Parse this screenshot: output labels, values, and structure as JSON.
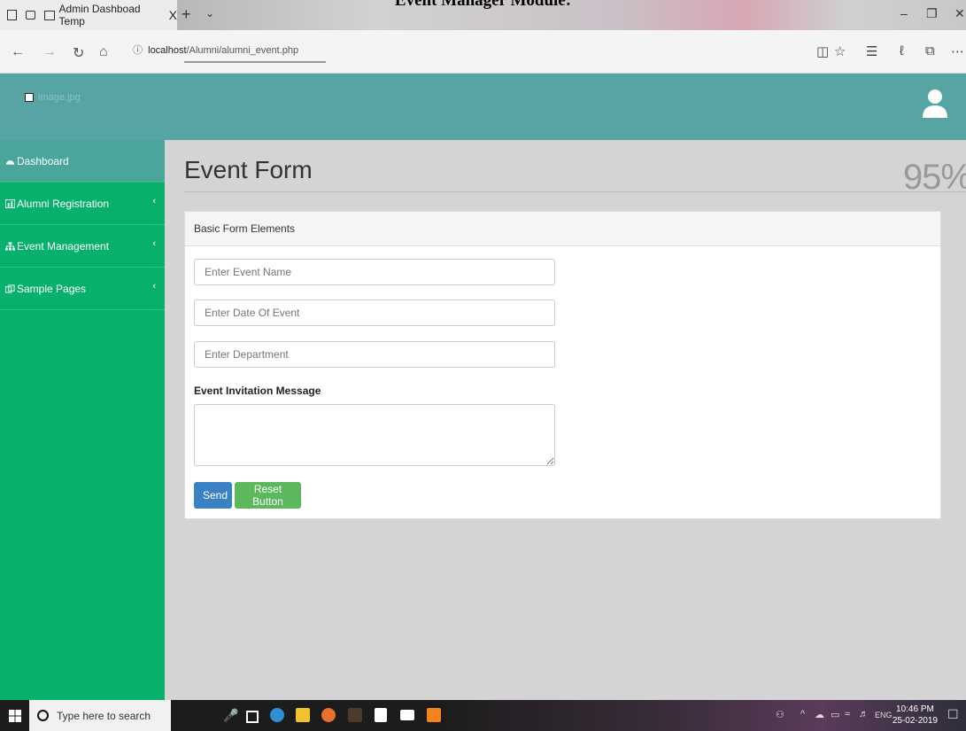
{
  "caption": "Event Manager Module:",
  "browser": {
    "tab_title": "Admin Dashboad Temp",
    "tab_close": "X",
    "new_tab": "+",
    "url_host": "localhost",
    "url_path": "/Alumni/alumni_event.php"
  },
  "header": {
    "logo_alt": "image.jpg"
  },
  "sidebar": {
    "items": [
      {
        "label": "Dashboard",
        "icon": "dashboard-icon"
      },
      {
        "label": "Alumni Registration",
        "icon": "chart-icon"
      },
      {
        "label": "Event Management",
        "icon": "sitemap-icon"
      },
      {
        "label": "Sample Pages",
        "icon": "pages-icon"
      }
    ]
  },
  "main": {
    "title": "Event Form",
    "percent": "95%",
    "panel_title": "Basic Form Elements",
    "event_name_placeholder": "Enter Event Name",
    "event_date_placeholder": "Enter Date Of Event",
    "department_placeholder": "Enter Department",
    "message_label": "Event Invitation Message",
    "send_label": "Send",
    "reset_label": "Reset Button"
  },
  "taskbar": {
    "search_placeholder": "Type here to search",
    "lang": "ENG",
    "time": "10:46 PM",
    "date": "25-02-2019"
  },
  "colors": {
    "header": "#56a4a4",
    "sidebar": "#07b06b",
    "sidebar_active": "#4aa69a",
    "send_button": "#3b82c4",
    "reset_button": "#5cb85c"
  }
}
